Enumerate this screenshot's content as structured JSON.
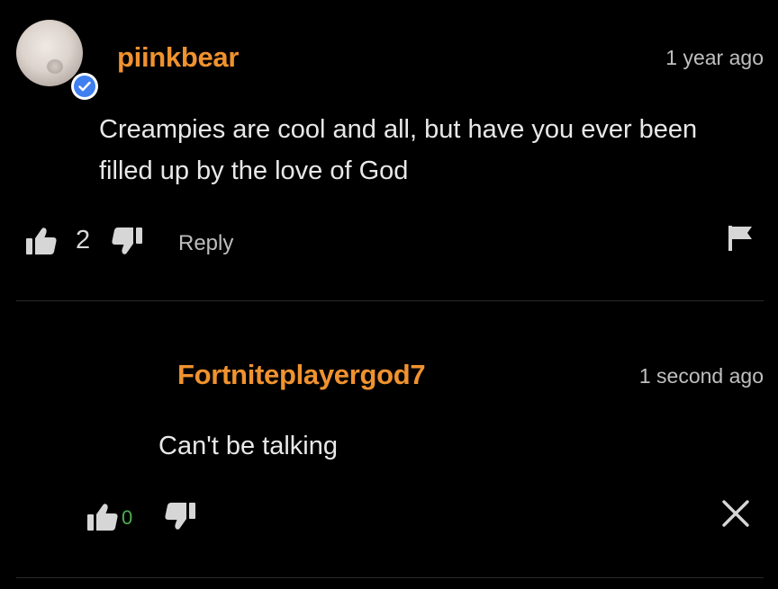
{
  "comments": [
    {
      "username": "piinkbear",
      "timestamp": "1 year ago",
      "body_line1": "Creampies are cool and all, but have you ever been",
      "body_line2": "filled up by the love of God",
      "like_count": "2",
      "reply_label": "Reply"
    },
    {
      "username": "Fortniteplayergod7",
      "timestamp": "1 second ago",
      "body": "Can't be talking",
      "like_count": "0"
    }
  ],
  "colors": {
    "username": "#f0922f",
    "verified_badge": "#3f7ff0",
    "like_count_zero": "#4caf50",
    "background": "#000000"
  },
  "icons": {
    "comment1": [
      "avatar",
      "verified-icon",
      "thumbs-up-icon",
      "thumbs-down-icon",
      "flag-icon"
    ],
    "comment2": [
      "thumbs-up-icon",
      "thumbs-down-icon",
      "close-icon"
    ]
  }
}
